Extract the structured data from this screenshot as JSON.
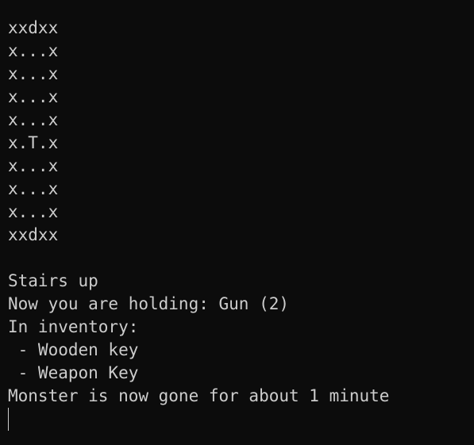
{
  "terminal": {
    "map_rows": [
      "xxdxx",
      "x...x",
      "x...x",
      "x...x",
      "x...x",
      "x.T.x",
      "x...x",
      "x...x",
      "x...x",
      "xxdxx"
    ],
    "location_text": "Stairs up",
    "holding_text": "Now you are holding: Gun (2)",
    "inventory_header": "In inventory:",
    "inventory_items": [
      " - Wooden key",
      " - Weapon Key"
    ],
    "status_text": "Monster is now gone for about 1 minute"
  },
  "colors": {
    "background": "#0c0c0c",
    "foreground": "#cccccc"
  }
}
